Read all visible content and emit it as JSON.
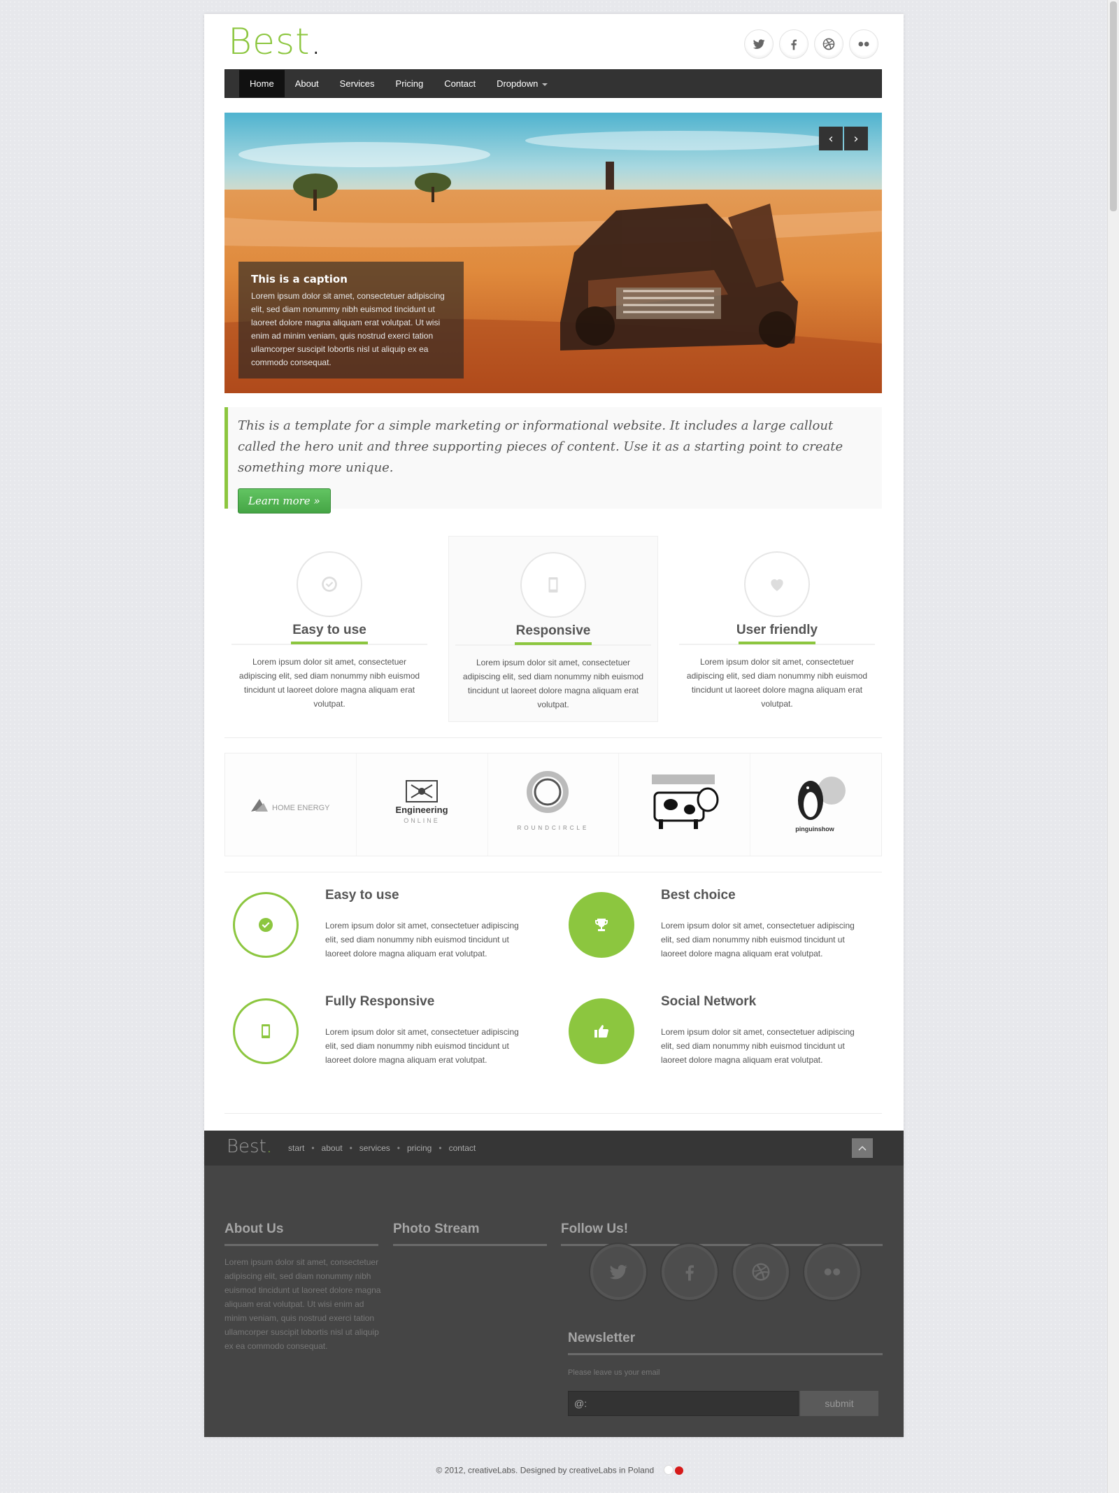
{
  "header": {
    "logo_text": "Best",
    "logo_dot": ".",
    "social": [
      "twitter-icon",
      "facebook-icon",
      "dribbble-icon",
      "flickr-icon"
    ]
  },
  "nav": {
    "items": [
      {
        "label": "Home",
        "active": true
      },
      {
        "label": "About"
      },
      {
        "label": "Services"
      },
      {
        "label": "Pricing"
      },
      {
        "label": "Contact"
      },
      {
        "label": "Dropdown",
        "dropdown": true
      }
    ]
  },
  "hero": {
    "prev_label": "‹",
    "next_label": "›",
    "caption_title": "This is a caption",
    "caption_text": "Lorem ipsum dolor sit amet, consectetuer adipiscing elit, sed diam nonummy nibh euismod tincidunt ut laoreet dolore magna aliquam erat volutpat. Ut wisi enim ad minim veniam, quis nostrud exerci tation ullamcorper suscipit lobortis nisl ut aliquip ex ea commodo consequat."
  },
  "callout": {
    "text": "This is a template for a simple marketing or informational website. It includes a large callout called the hero unit and three supporting pieces of content. Use it as a starting point to create something more unique.",
    "button": "Learn more »"
  },
  "features": [
    {
      "title": "Easy to use",
      "icon": "check-circle-icon",
      "text": "Lorem ipsum dolor sit amet, consectetuer adipiscing elit, sed diam nonummy nibh euismod tincidunt ut laoreet dolore magna aliquam erat volutpat."
    },
    {
      "title": "Responsive",
      "icon": "mobile-icon",
      "text": "Lorem ipsum dolor sit amet, consectetuer adipiscing elit, sed diam nonummy nibh euismod tincidunt ut laoreet dolore magna aliquam erat volutpat."
    },
    {
      "title": "User friendly",
      "icon": "heart-icon",
      "text": "Lorem ipsum dolor sit amet, consectetuer adipiscing elit, sed diam nonummy nibh euismod tincidunt ut laoreet dolore magna aliquam erat volutpat."
    }
  ],
  "clients": [
    {
      "name": "HOME ENERGY"
    },
    {
      "name": "Engineering",
      "sub": "ONLINE"
    },
    {
      "name": "ROUNDCIRCLE"
    },
    {
      "name": "cow-logo"
    },
    {
      "name": "pinguinshow"
    }
  ],
  "services": [
    {
      "title": "Easy to use",
      "icon": "check-icon",
      "style": "outline",
      "text": "Lorem ipsum dolor sit amet, consectetuer adipiscing elit, sed diam nonummy nibh euismod tincidunt ut laoreet dolore magna aliquam erat volutpat."
    },
    {
      "title": "Best choice",
      "icon": "trophy-icon",
      "style": "filled",
      "text": "Lorem ipsum dolor sit amet, consectetuer adipiscing elit, sed diam nonummy nibh euismod tincidunt ut laoreet dolore magna aliquam erat volutpat."
    },
    {
      "title": "Fully Responsive",
      "icon": "mobile-icon",
      "style": "outline",
      "text": "Lorem ipsum dolor sit amet, consectetuer adipiscing elit, sed diam nonummy nibh euismod tincidunt ut laoreet dolore magna aliquam erat volutpat."
    },
    {
      "title": "Social Network",
      "icon": "thumbs-up-icon",
      "style": "filled",
      "text": "Lorem ipsum dolor sit amet, consectetuer adipiscing elit, sed diam nonummy nibh euismod tincidunt ut laoreet dolore magna aliquam erat volutpat."
    }
  ],
  "footer": {
    "logo_text": "Best",
    "logo_dot": ".",
    "nav": [
      "start",
      "about",
      "services",
      "pricing",
      "contact"
    ],
    "about_title": "About Us",
    "about_text": "Lorem ipsum dolor sit amet, consectetuer adipiscing elit, sed diam nonummy nibh euismod tincidunt ut laoreet dolore magna aliquam erat volutpat. Ut wisi enim ad minim veniam, quis nostrud exerci tation ullamcorper suscipit lobortis nisl ut aliquip ex ea commodo consequat.",
    "photo_title": "Photo Stream",
    "follow_title": "Follow Us!",
    "newsletter_title": "Newsletter",
    "newsletter_hint": "Please leave us your email",
    "email_placeholder": "@:",
    "submit_label": "submit"
  },
  "copyright": "© 2012, creativeLabs. Designed by creativeLabs in Poland",
  "colors": {
    "accent": "#8cc63f",
    "nav_bg": "#333333",
    "footer_bg": "#454545"
  }
}
